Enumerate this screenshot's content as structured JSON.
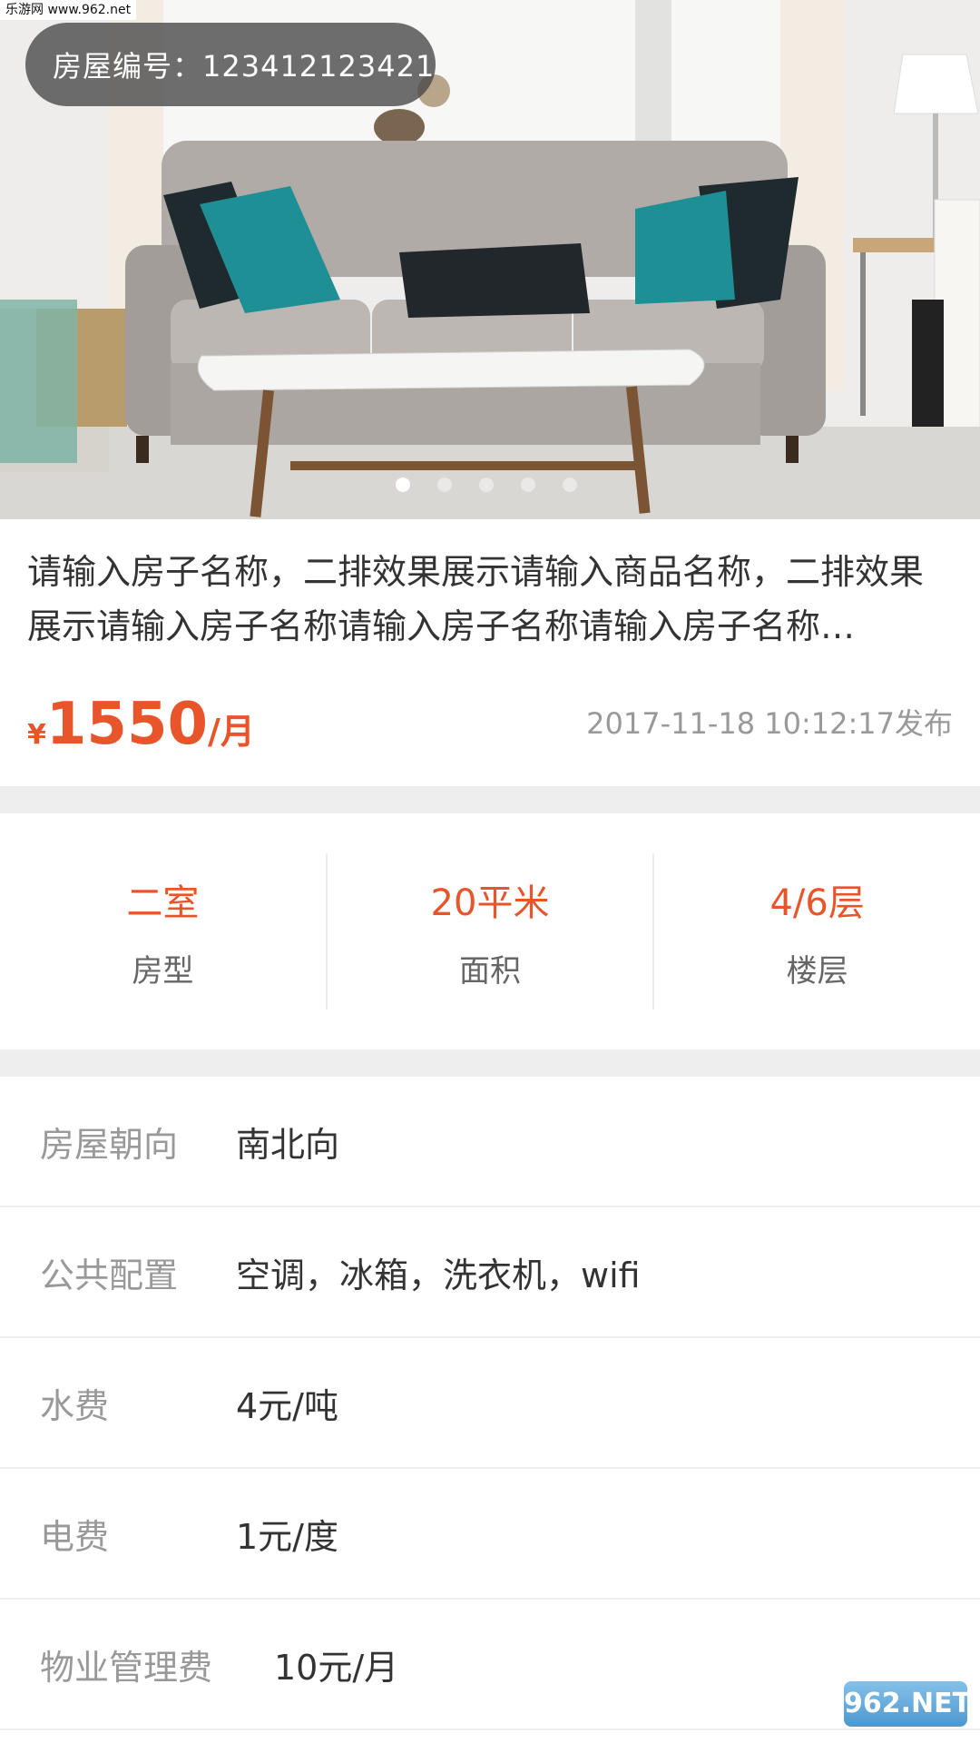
{
  "watermark_top": "乐游网 www.962.net",
  "hero": {
    "house_number": "房屋编号：123412123421",
    "dots_count": 5,
    "active_dot": 0
  },
  "listing": {
    "title": "请输入房子名称，二排效果展示请输入商品名称，二排效果展示请输入房子名称请输入房子名称请输入房子名称…",
    "price_currency": "¥",
    "price_value": "1550",
    "price_unit": "/月",
    "publish_time": "2017-11-18 10:12:17发布"
  },
  "stats": [
    {
      "value": "二室",
      "label": "房型"
    },
    {
      "value": "20平米",
      "label": "面积"
    },
    {
      "value": "4/6层",
      "label": "楼层"
    }
  ],
  "details": [
    {
      "label": "房屋朝向",
      "value": "南北向"
    },
    {
      "label": "公共配置",
      "value": "空调，冰箱，洗衣机，wifi"
    },
    {
      "label": "水费",
      "value": "4元/吨"
    },
    {
      "label": "电费",
      "value": "1元/度"
    },
    {
      "label": "物业管理费",
      "value": "10元/月"
    }
  ],
  "watermark_bottom": "962.NET",
  "colors": {
    "accent": "#e8552b",
    "muted": "#999999",
    "text": "#333333",
    "divider": "#eeeeee"
  }
}
